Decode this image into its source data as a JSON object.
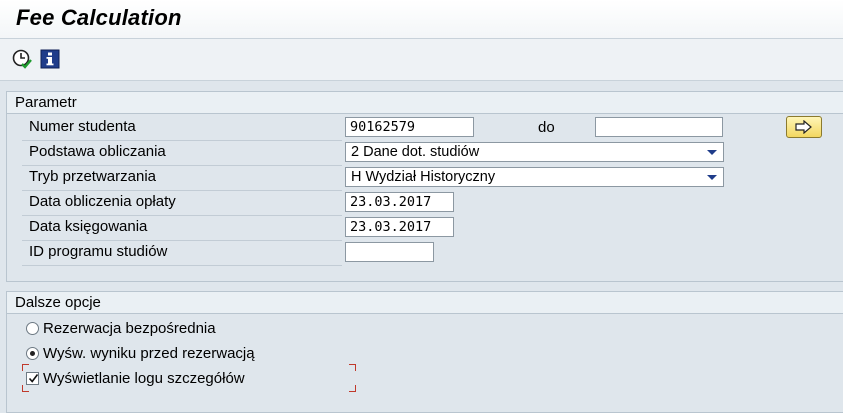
{
  "window": {
    "title": "Fee Calculation"
  },
  "toolbar": {
    "execute_icon": "clock-execute-icon",
    "info_icon": "info-icon"
  },
  "parametr": {
    "header": "Parametr",
    "student_number": {
      "label": "Numer studenta",
      "value": "90162579",
      "to_label": "do",
      "to_value": ""
    },
    "basis": {
      "label": "Podstawa obliczania",
      "value": "2 Dane dot. studiów"
    },
    "processing_mode": {
      "label": "Tryb przetwarzania",
      "value": "H Wydział Historyczny"
    },
    "fee_date": {
      "label": "Data obliczenia opłaty",
      "value": "23.03.2017"
    },
    "posting_date": {
      "label": "Data księgowania",
      "value": "23.03.2017"
    },
    "program_id": {
      "label": "ID programu studiów",
      "value": ""
    }
  },
  "options": {
    "header": "Dalsze opcje",
    "radio_direct": {
      "label": "Rezerwacja bezpośrednia",
      "selected": false
    },
    "radio_preview": {
      "label": "Wyśw. wyniku przed rezerwacją",
      "selected": true
    },
    "detail_log": {
      "label": "Wyświetlanie logu szczegółów",
      "checked": true
    }
  },
  "colors": {
    "accent": "#1f3c8a",
    "background": "#dfe6ec",
    "nav_button": "#f3d760"
  }
}
